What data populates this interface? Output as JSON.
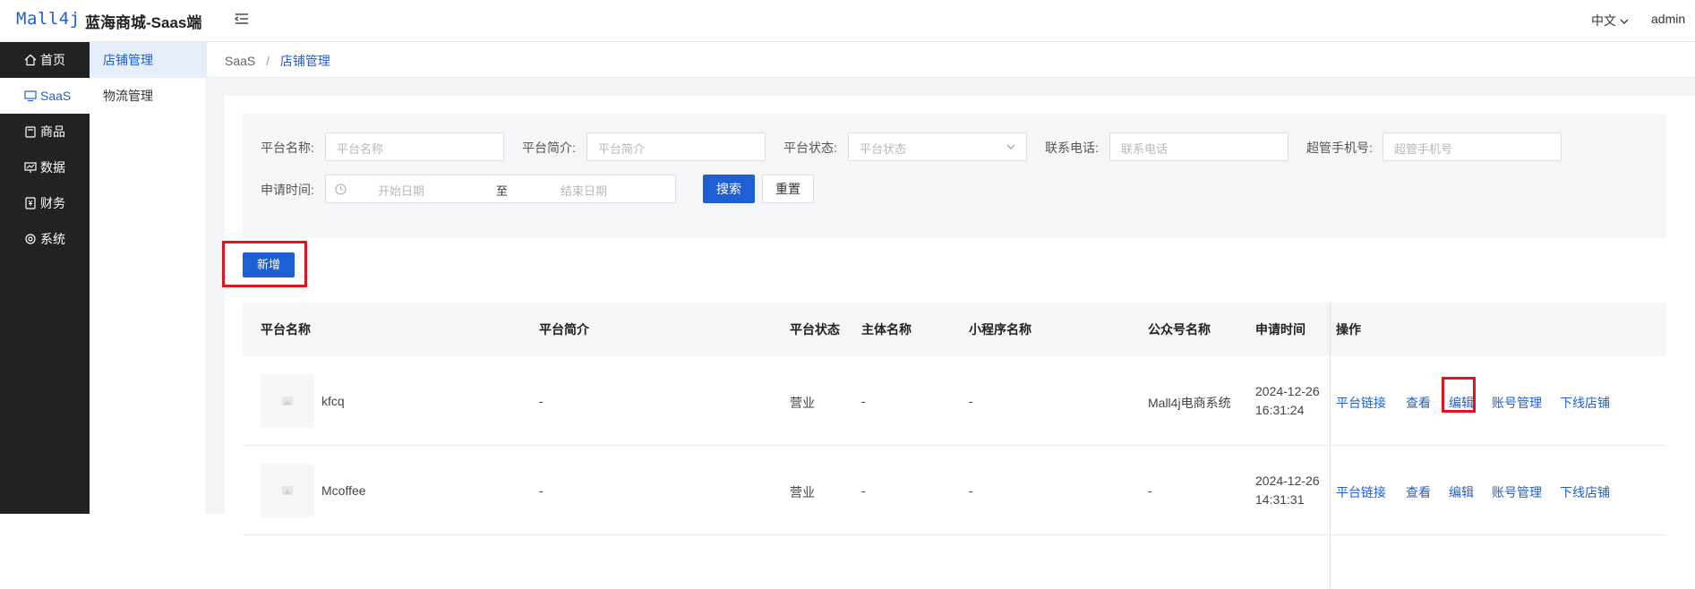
{
  "header": {
    "logo": "Mall4j",
    "app_title": "蓝海商城-Saas端",
    "language": "中文",
    "user": "admin"
  },
  "sidebar": {
    "items": [
      {
        "label": "首页",
        "icon": "home-icon"
      },
      {
        "label": "SaaS",
        "icon": "monitor-icon"
      },
      {
        "label": "商品",
        "icon": "bag-icon"
      },
      {
        "label": "数据",
        "icon": "chart-icon"
      },
      {
        "label": "财务",
        "icon": "finance-icon"
      },
      {
        "label": "系统",
        "icon": "gear-icon"
      }
    ]
  },
  "submenu": {
    "items": [
      {
        "label": "店铺管理"
      },
      {
        "label": "物流管理"
      }
    ]
  },
  "breadcrumb": {
    "root": "SaaS",
    "separator": "/",
    "current": "店铺管理"
  },
  "search": {
    "platform_name_label": "平台名称:",
    "platform_name_placeholder": "平台名称",
    "platform_intro_label": "平台简介:",
    "platform_intro_placeholder": "平台简介",
    "platform_status_label": "平台状态:",
    "platform_status_placeholder": "平台状态",
    "phone_label": "联系电话:",
    "phone_placeholder": "联系电话",
    "admin_phone_label": "超管手机号:",
    "admin_phone_placeholder": "超管手机号",
    "apply_time_label": "申请时间:",
    "start_date_placeholder": "开始日期",
    "range_separator": "至",
    "end_date_placeholder": "结束日期",
    "search_button": "搜索",
    "reset_button": "重置"
  },
  "actions": {
    "add_button": "新增"
  },
  "table": {
    "columns": [
      "平台名称",
      "平台简介",
      "平台状态",
      "主体名称",
      "小程序名称",
      "公众号名称",
      "申请时间",
      "操作"
    ],
    "rows": [
      {
        "name": "kfcq",
        "intro": "-",
        "status": "营业",
        "entity": "-",
        "mini_program": "-",
        "official_account": "Mall4j电商系统",
        "apply_date": "2024-12-26",
        "apply_time": "16:31:24"
      },
      {
        "name": "Mcoffee",
        "intro": "-",
        "status": "营业",
        "entity": "-",
        "mini_program": "-",
        "official_account": "-",
        "apply_date": "2024-12-26",
        "apply_time": "14:31:31"
      }
    ],
    "operations": [
      "平台链接",
      "查看",
      "编辑",
      "账号管理",
      "下线店铺"
    ]
  },
  "colors": {
    "accent": "#1f5fd4",
    "sidebar_bg": "#222222",
    "highlight_box": "#e0141e"
  }
}
